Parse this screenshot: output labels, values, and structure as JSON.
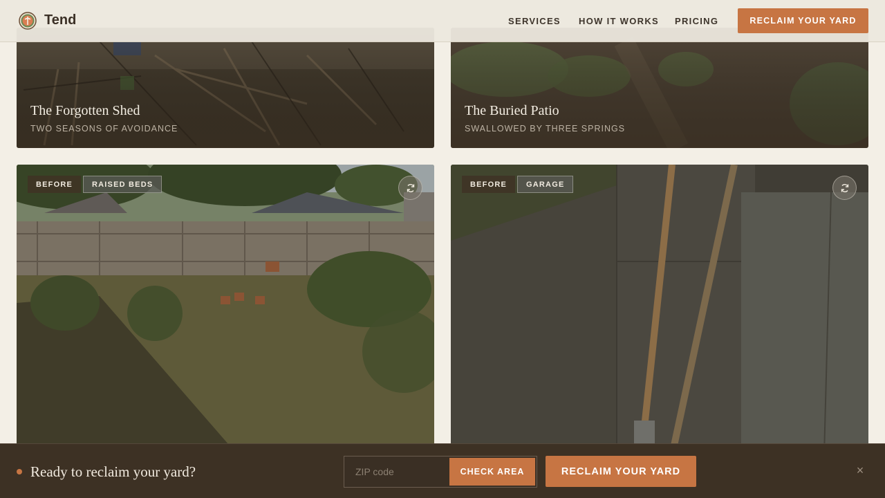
{
  "header": {
    "brand": "Tend",
    "nav": [
      "SERVICES",
      "HOW IT WORKS",
      "PRICING"
    ],
    "cta": "RECLAIM YOUR YARD"
  },
  "cards_top": [
    {
      "title": "The Forgotten Shed",
      "subtitle": "TWO SEASONS OF AVOIDANCE"
    },
    {
      "title": "The Buried Patio",
      "subtitle": "SWALLOWED BY THREE SPRINGS"
    }
  ],
  "cards_bottom": [
    {
      "badge": "BEFORE",
      "category": "RAISED BEDS",
      "icon": "swap-icon"
    },
    {
      "badge": "BEFORE",
      "category": "GARAGE",
      "icon": "swap-icon"
    }
  ],
  "bottom_bar": {
    "prompt": "Ready to reclaim your yard?",
    "zip_placeholder": "ZIP code",
    "check_label": "CHECK AREA",
    "cta": "RECLAIM YOUR YARD",
    "close_glyph": "×"
  },
  "colors": {
    "accent": "#c77543",
    "dark": "#3d3124",
    "page": "#f3efe6"
  }
}
